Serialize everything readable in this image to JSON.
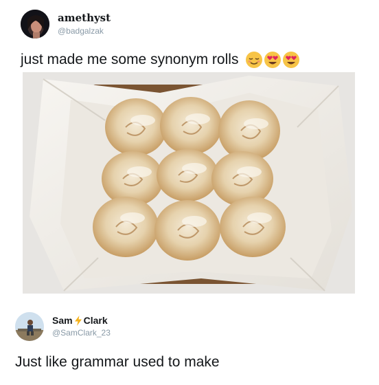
{
  "tweet1": {
    "author_name": "amethyst",
    "author_handle": "@badgalzak",
    "text": "just made me some synonym rolls",
    "emojis": [
      "relieved-face-emoji",
      "heart-eyes-emoji",
      "heart-eyes-emoji"
    ],
    "image_alt": "cinnamon-rolls-photo"
  },
  "tweet2": {
    "author_first": "Sam",
    "author_last": "Clark",
    "name_icon": "lightning-bolt-icon",
    "author_handle": "@SamClark_23",
    "text": "Just like grammar used to make"
  },
  "colors": {
    "text": "#14171a",
    "muted": "#8899a6",
    "emoji_yellow": "#f7c447",
    "heart": "#e0245e"
  }
}
